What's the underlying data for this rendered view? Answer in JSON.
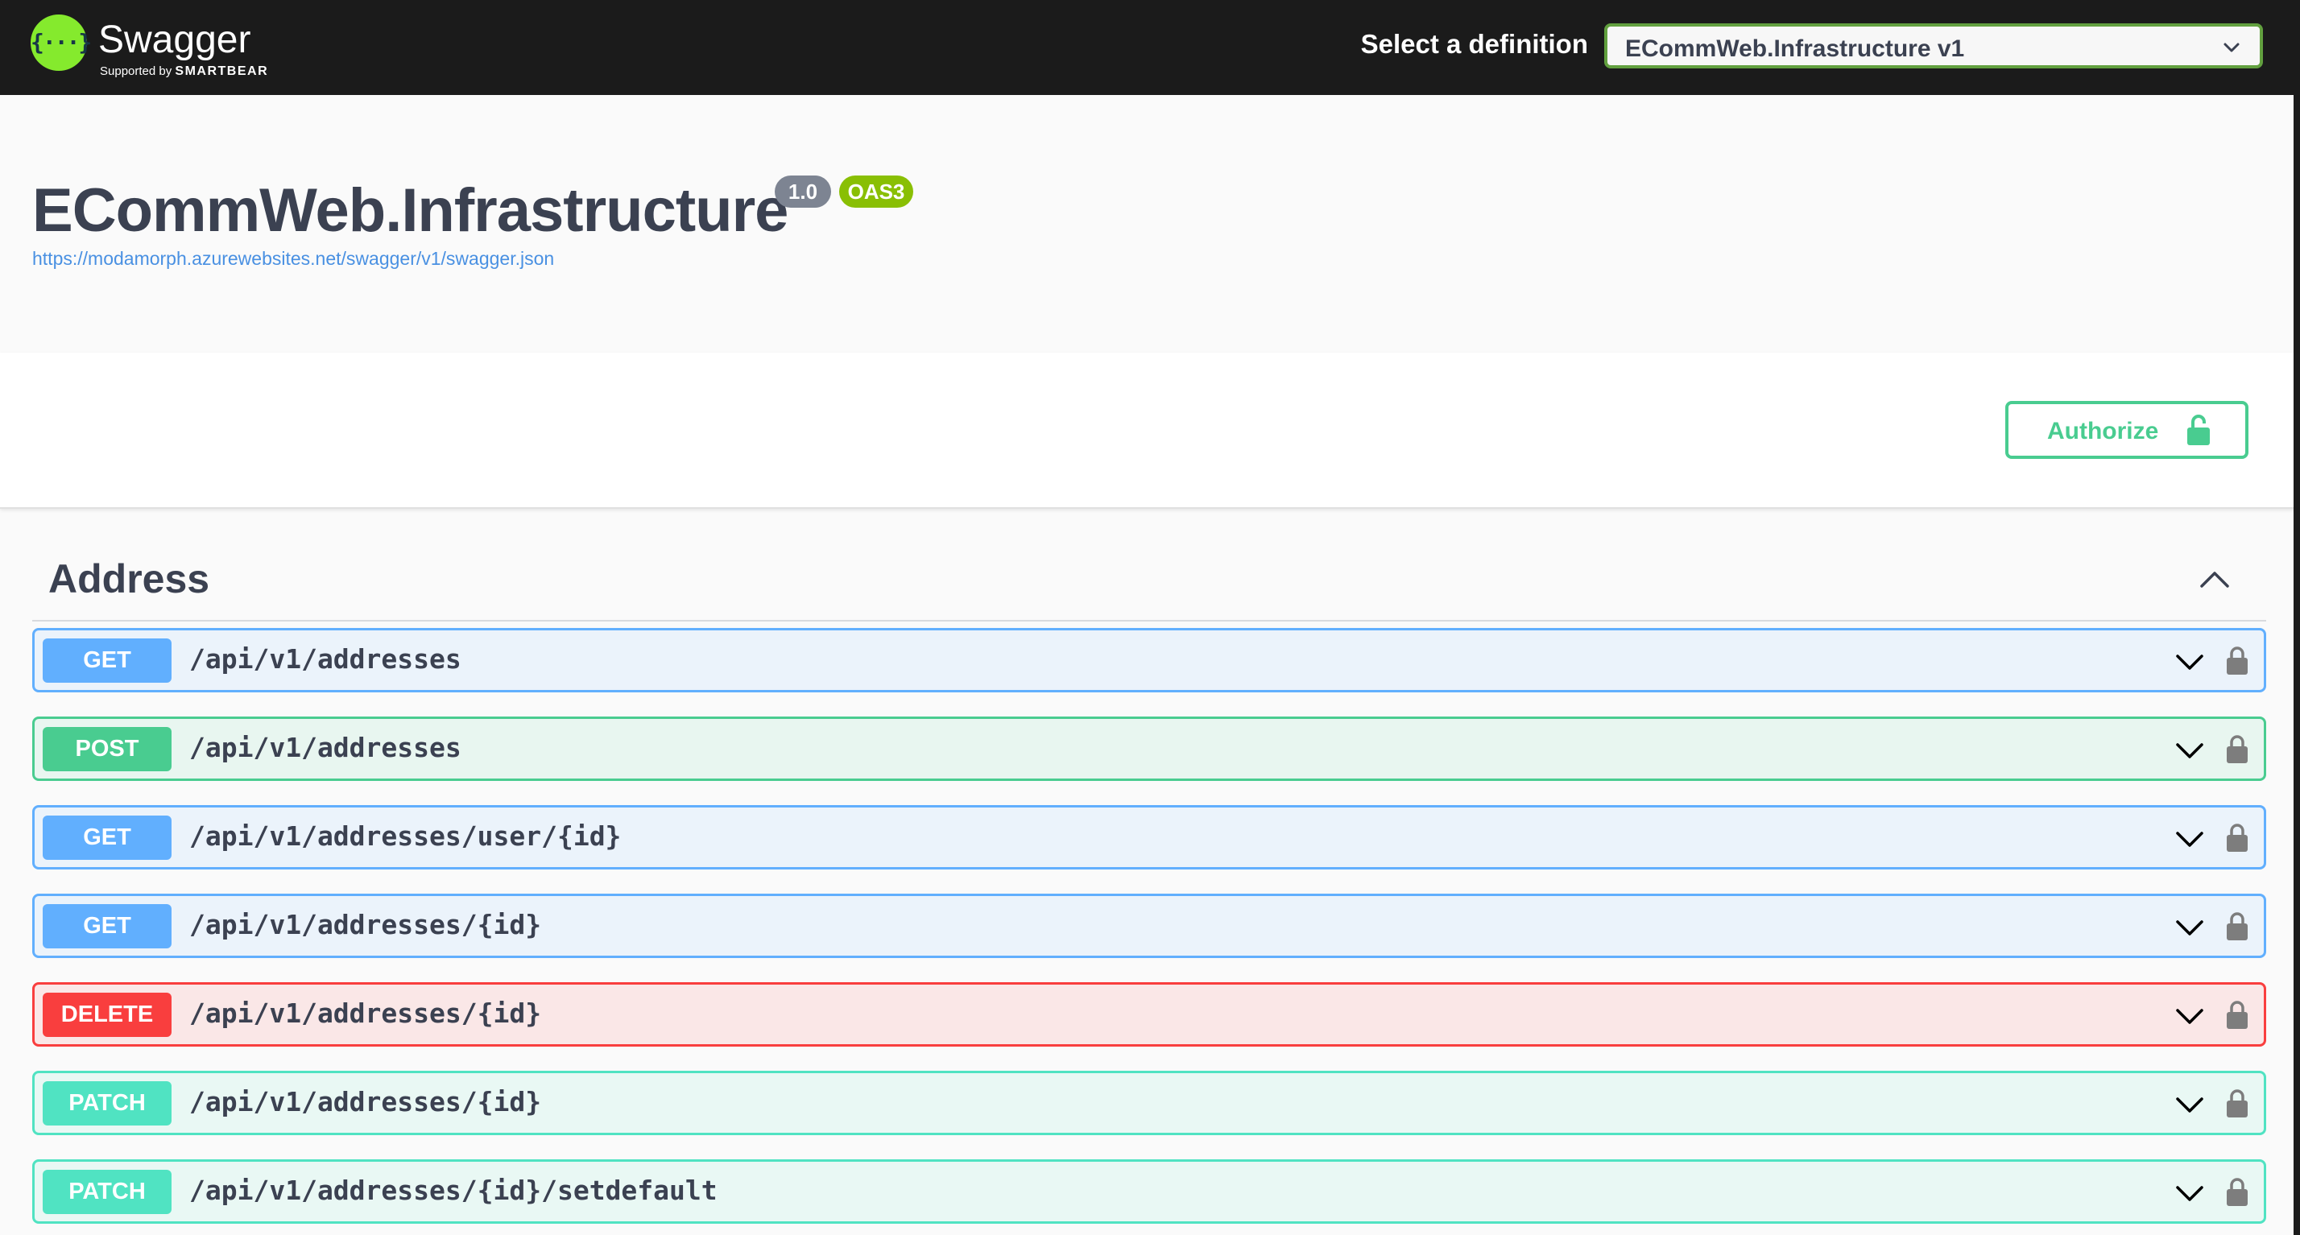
{
  "topbar": {
    "logo_glyph": "{···}",
    "logo_name": "Swagger",
    "logo_sub_prefix": "Supported by",
    "logo_sub_brand": "SMARTBEAR",
    "definition_label": "Select a definition",
    "definition_selected": "ECommWeb.Infrastructure v1",
    "accent_color": "#85ea2d"
  },
  "info": {
    "title": "ECommWeb.Infrastructure",
    "version": "1.0",
    "oas_badge": "OAS3",
    "spec_url": "https://modamorph.azurewebsites.net/swagger/v1/swagger.json"
  },
  "scheme": {
    "authorize_label": "Authorize",
    "authorize_icon": "lock-open-icon"
  },
  "tag": {
    "name": "Address",
    "toggle_icon": "chevron-up-icon"
  },
  "operations": [
    {
      "method": "GET",
      "path": "/api/v1/addresses",
      "kind": "get"
    },
    {
      "method": "POST",
      "path": "/api/v1/addresses",
      "kind": "post"
    },
    {
      "method": "GET",
      "path": "/api/v1/addresses/user/{id}",
      "kind": "get"
    },
    {
      "method": "GET",
      "path": "/api/v1/addresses/{id}",
      "kind": "get"
    },
    {
      "method": "DELETE",
      "path": "/api/v1/addresses/{id}",
      "kind": "delete"
    },
    {
      "method": "PATCH",
      "path": "/api/v1/addresses/{id}",
      "kind": "patch"
    },
    {
      "method": "PATCH",
      "path": "/api/v1/addresses/{id}/setdefault",
      "kind": "patch"
    }
  ],
  "method_colors": {
    "get": "#61affe",
    "post": "#49cc90",
    "delete": "#f93e3e",
    "patch": "#50e3c2"
  }
}
